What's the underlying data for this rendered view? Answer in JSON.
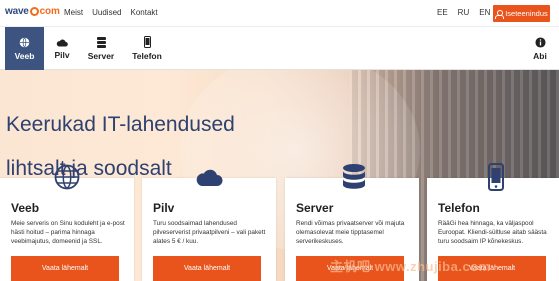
{
  "brand": {
    "logo_left": "wave",
    "logo_right": "com"
  },
  "top_nav": {
    "items": [
      "Meist",
      "Uudised",
      "Kontakt"
    ]
  },
  "languages": [
    "EE",
    "RU",
    "EN"
  ],
  "login": {
    "label": "Iseteenindus"
  },
  "service_nav": {
    "items": [
      {
        "label": "Veeb",
        "icon": "globe-icon",
        "active": true
      },
      {
        "label": "Pilv",
        "icon": "cloud-icon",
        "active": false
      },
      {
        "label": "Server",
        "icon": "server-icon",
        "active": false
      },
      {
        "label": "Telefon",
        "icon": "phone-icon",
        "active": false
      }
    ],
    "help": {
      "label": "Abi",
      "icon": "info-icon"
    }
  },
  "hero": {
    "line1": "Keerukad IT-lahendused",
    "line2": "lihtsalt  ja soodsalt"
  },
  "cards": [
    {
      "title": "Veeb",
      "icon": "globe-icon",
      "text": "Meie serveris on Sinu koduleht ja e-post hästi hoitud – parima hinnaga veebimajutus, domeenid ja SSL.",
      "button": "Vaata lähemalt"
    },
    {
      "title": "Pilv",
      "icon": "cloud-icon",
      "text": "Turu soodsaimad lahendused pilveserverist privaatpilveni – vali pakett alates 5 € / kuu.",
      "button": "Vaata lähemalt"
    },
    {
      "title": "Server",
      "icon": "server-icon",
      "text": "Rendi võimas privaatserver või majuta olemasolevat meie tipptasemel serverikeskuses.",
      "button": "Vaata lähemalt"
    },
    {
      "title": "Telefon",
      "icon": "phone-icon",
      "text": "RääGi hea hinnaga, ka väljaspool Euroopat. Kliendi-sültluse aitab säästa turu soodsaim IP kõnekeskus.",
      "button": "Vaata lähemalt"
    }
  ],
  "watermark": "主机吧 www.zhujiba.com",
  "colors": {
    "accent": "#e8541b",
    "nav_active": "#3e5480",
    "hero_title": "#2e4170"
  }
}
